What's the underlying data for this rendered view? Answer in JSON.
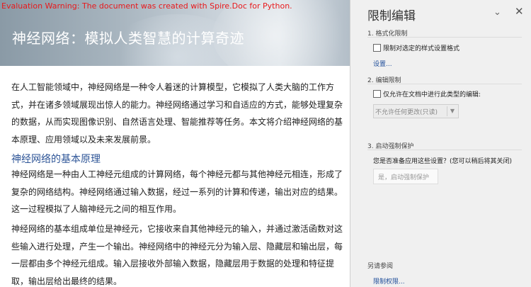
{
  "document": {
    "warning": "Evaluation Warning: The document was created with Spire.Doc for Python.",
    "title": "神经网络：模拟人类智慧的计算奇迹",
    "intro_lines": [
      "在人工智能领域中，神经网络是一种令人着迷的计算模型，它模拟了人类大脑的工作方",
      "式，并在诸多领域展现出惊人的能力。神经网络通过学习和自适应的方式，能够处理复杂",
      "的数据，从而实现图像识别、自然语言处理、智能推荐等任务。本文将介绍神经网络的基",
      "本原理、应用领域以及未来发展前景。"
    ],
    "heading": "神经网络的基本原理",
    "para1_lines": [
      "神经网络是一种由人工神经元组成的计算网络，每个神经元都与其他神经元相连，形成了",
      "复杂的网络结构。神经网络通过输入数据，经过一系列的计算和传递，输出对应的结果。",
      "这一过程模拟了人脑神经元之间的相互作用。"
    ],
    "para2_lines": [
      "神经网络的基本组成单位是神经元，它接收来自其他神经元的输入，并通过激活函数对这",
      "些输入进行处理，产生一个输出。神经网络中的神经元分为输入层、隐藏层和输出层，每",
      "一层都由多个神经元组成。输入层接收外部输入数据，隐藏层用于数据的处理和特征提",
      "取，输出层给出最终的结果。"
    ]
  },
  "pane": {
    "title": "限制编辑",
    "options_icon": "chevron-down-icon",
    "close_icon": "close-icon",
    "section1": {
      "label": "1. 格式化限制",
      "checkbox_label": "限制对选定的样式设置格式",
      "checked": false,
      "settings_link": "设置..."
    },
    "section2": {
      "label": "2. 编辑限制",
      "checkbox_label": "仅允许在文档中进行此类型的编辑:",
      "checked": false,
      "dropdown_value": "不允许任何更改(只读)"
    },
    "section3": {
      "label": "3. 启动强制保护",
      "question": "您是否准备应用这些设置？(您可以稍后将其关闭)",
      "button_label": "是，启动强制保护"
    },
    "see_also": {
      "label": "另请参阅",
      "link": "限制权限..."
    }
  }
}
